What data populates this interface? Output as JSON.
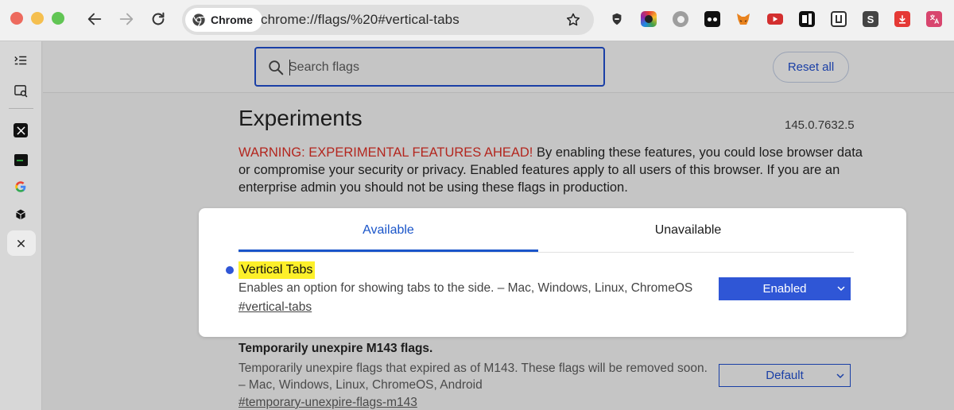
{
  "browser": {
    "omnibox_chip": "Chrome",
    "url": "chrome://flags/%20#vertical-tabs",
    "extensions": [
      "shield-icon",
      "colorwheel-icon",
      "circle-icon",
      "dots-icon",
      "fox-icon",
      "youtube-icon",
      "n-icon",
      "u-icon",
      "s-icon",
      "download-icon",
      "translate-icon"
    ],
    "extension_letters": {
      "s": "S"
    }
  },
  "sidestrip": {
    "items": [
      "collapse-icon",
      "search-tabs-icon",
      "x-logo-icon",
      "terminal-icon",
      "google-icon",
      "cube-icon",
      "close-icon"
    ]
  },
  "search": {
    "placeholder": "Search flags",
    "value": ""
  },
  "reset_label": "Reset all",
  "page": {
    "title": "Experiments",
    "version": "145.0.7632.5",
    "warning_prefix": "WARNING: EXPERIMENTAL FEATURES AHEAD!",
    "warning_text": " By enabling these features, you could lose browser data or compromise your security or privacy. Enabled features apply to all users of this browser. If you are an enterprise admin you should not be using these flags in production."
  },
  "tabs": {
    "available": "Available",
    "unavailable": "Unavailable"
  },
  "flags": [
    {
      "name": "Vertical Tabs",
      "description": "Enables an option for showing tabs to the side. – Mac, Windows, Linux, ChromeOS",
      "link": "#vertical-tabs",
      "state": "Enabled"
    },
    {
      "name": "Temporarily unexpire M143 flags.",
      "description": "Temporarily unexpire flags that expired as of M143. These flags will be removed soon. – Mac, Windows, Linux, ChromeOS, Android",
      "link": "#temporary-unexpire-flags-m143",
      "state": "Default"
    }
  ],
  "colors": {
    "accent": "#2f56d6",
    "warning": "#b3261e",
    "highlight": "#fdf02a"
  }
}
